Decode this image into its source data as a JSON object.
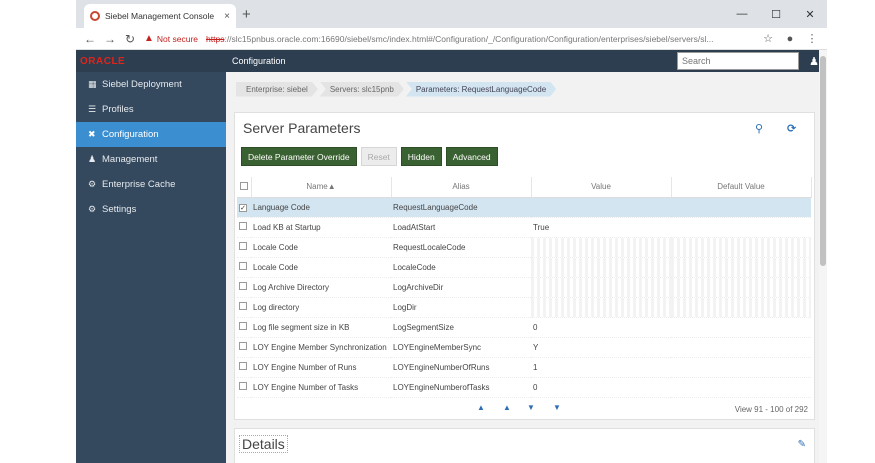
{
  "browser": {
    "tab_title": "Siebel Management Console",
    "tab_close": "×",
    "new_tab": "+",
    "win_min": "—",
    "win_max": "☐",
    "win_close": "✕",
    "not_secure": "Not secure",
    "url_scheme": "https",
    "url_rest": "://slc15pnbus.oracle.com:16690/siebel/smc/index.html#/Configuration/_/Configuration/Configuration/enterprises/siebel/servers/sl..."
  },
  "header": {
    "logo": "ORACLE",
    "title": "Configuration",
    "search_placeholder": "Search"
  },
  "sidebar": {
    "items": [
      {
        "label": "Siebel Deployment",
        "icon": "sitemap-icon"
      },
      {
        "label": "Profiles",
        "icon": "list-icon"
      },
      {
        "label": "Configuration",
        "icon": "wrench-icon"
      },
      {
        "label": "Management",
        "icon": "users-icon"
      },
      {
        "label": "Enterprise Cache",
        "icon": "gear-icon"
      },
      {
        "label": "Settings",
        "icon": "settings-icon"
      }
    ]
  },
  "breadcrumbs": [
    "Enterprise: siebel",
    "Servers: slc15pnb",
    "Parameters: RequestLanguageCode"
  ],
  "panel": {
    "title": "Server Parameters",
    "buttons": {
      "delete": "Delete Parameter Override",
      "reset": "Reset",
      "hidden": "Hidden",
      "advanced": "Advanced"
    }
  },
  "table": {
    "columns": [
      "Name▲",
      "Alias",
      "Value",
      "Default Value"
    ],
    "rows": [
      {
        "name": "Language Code",
        "alias": "RequestLanguageCode",
        "value": "",
        "default": "",
        "checked": "✓"
      },
      {
        "name": "Load KB at Startup",
        "alias": "LoadAtStart",
        "value": "True",
        "default": "",
        "checked": ""
      },
      {
        "name": "Locale Code",
        "alias": "RequestLocaleCode",
        "value": "",
        "default": "",
        "checked": ""
      },
      {
        "name": "Locale Code",
        "alias": "LocaleCode",
        "value": "",
        "default": "",
        "checked": ""
      },
      {
        "name": "Log Archive Directory",
        "alias": "LogArchiveDir",
        "value": "",
        "default": "",
        "checked": ""
      },
      {
        "name": "Log directory",
        "alias": "LogDir",
        "value": "",
        "default": "",
        "checked": ""
      },
      {
        "name": "Log file segment size in KB",
        "alias": "LogSegmentSize",
        "value": "0",
        "default": "",
        "checked": ""
      },
      {
        "name": "LOY Engine Member Synchronization",
        "alias": "LOYEngineMemberSync",
        "value": "Y",
        "default": "",
        "checked": ""
      },
      {
        "name": "LOY Engine Number of Runs",
        "alias": "LOYEngineNumberOfRuns",
        "value": "1",
        "default": "",
        "checked": ""
      },
      {
        "name": "LOY Engine Number of Tasks",
        "alias": "LOYEngineNumberofTasks",
        "value": "0",
        "default": "",
        "checked": ""
      }
    ]
  },
  "pager": {
    "first": "▲",
    "prev": "▲",
    "next": "▼",
    "last": "▼",
    "info": "View 91 - 100 of 292"
  },
  "details": {
    "title": "Details"
  }
}
